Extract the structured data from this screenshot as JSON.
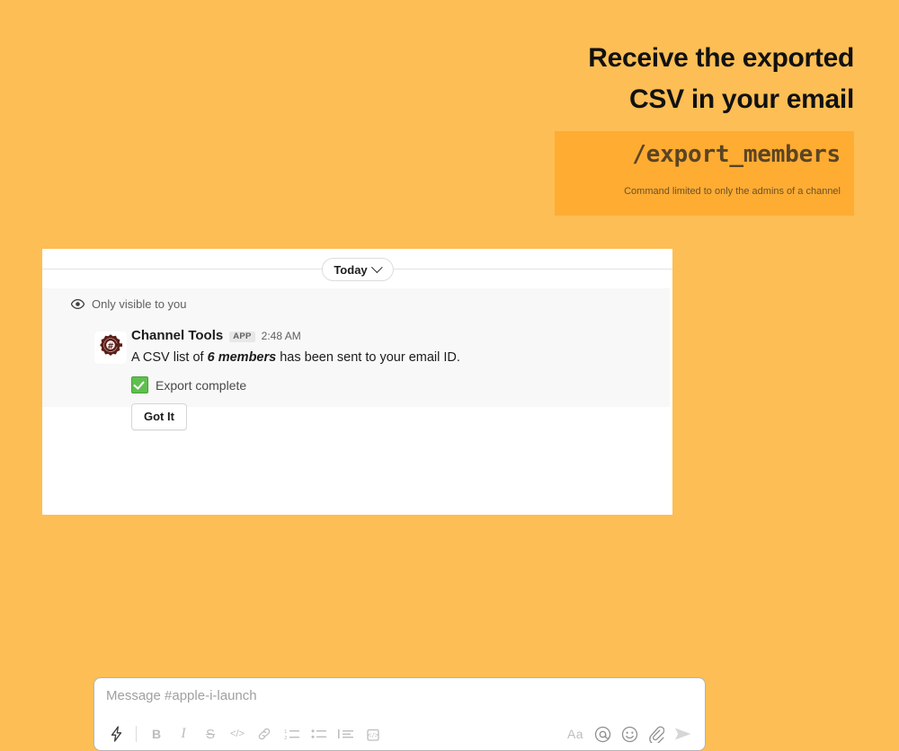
{
  "theme": {
    "page_background": "#fdbe55",
    "command_card_background": "#ffac33",
    "command_text_color": "#5b4423",
    "card_background": "#ffffff",
    "ephemeral_background": "#f8f8f8",
    "check_green": "#5fbf4e"
  },
  "headline": {
    "line1": "Receive the exported",
    "line2": "CSV in your email"
  },
  "command": {
    "text": "/export_members",
    "note": "Command limited to only the admins of a channel"
  },
  "slack": {
    "date_divider": {
      "label": "Today",
      "chevron_icon": "chevron-down-icon"
    },
    "ephemeral": {
      "eye_icon": "eye-icon",
      "visibility_note": "Only visible to you"
    },
    "message": {
      "avatar_icon": "gear-hash-app-avatar-icon",
      "app_name": "Channel Tools",
      "app_badge": "APP",
      "timestamp": "2:48 AM",
      "text_before": "A CSV list of ",
      "text_highlight": "6 members",
      "text_after": " has been sent to your email ID.",
      "attachment_emoji": "white-check-mark-emoji",
      "attachment_text": "Export complete",
      "button_label": "Got It"
    },
    "composer": {
      "placeholder": "Message #apple-i-launch",
      "value": "",
      "toolbar_left": [
        {
          "name": "lightning-shortcuts-icon",
          "label": ""
        },
        {
          "name": "bold-icon",
          "label": "B"
        },
        {
          "name": "italic-icon",
          "label": "I"
        },
        {
          "name": "strikethrough-icon",
          "label": "S"
        },
        {
          "name": "inline-code-icon",
          "label": "</>"
        },
        {
          "name": "link-icon",
          "label": ""
        },
        {
          "name": "ordered-list-icon",
          "label": ""
        },
        {
          "name": "bulleted-list-icon",
          "label": ""
        },
        {
          "name": "blockquote-icon",
          "label": ""
        },
        {
          "name": "code-block-icon",
          "label": ""
        }
      ],
      "toolbar_right": [
        {
          "name": "formatting-toggle-icon",
          "label": "Aa"
        },
        {
          "name": "mention-icon",
          "label": "@"
        },
        {
          "name": "emoji-icon",
          "label": ""
        },
        {
          "name": "attachment-icon",
          "label": ""
        },
        {
          "name": "send-icon",
          "label": ""
        }
      ]
    }
  }
}
